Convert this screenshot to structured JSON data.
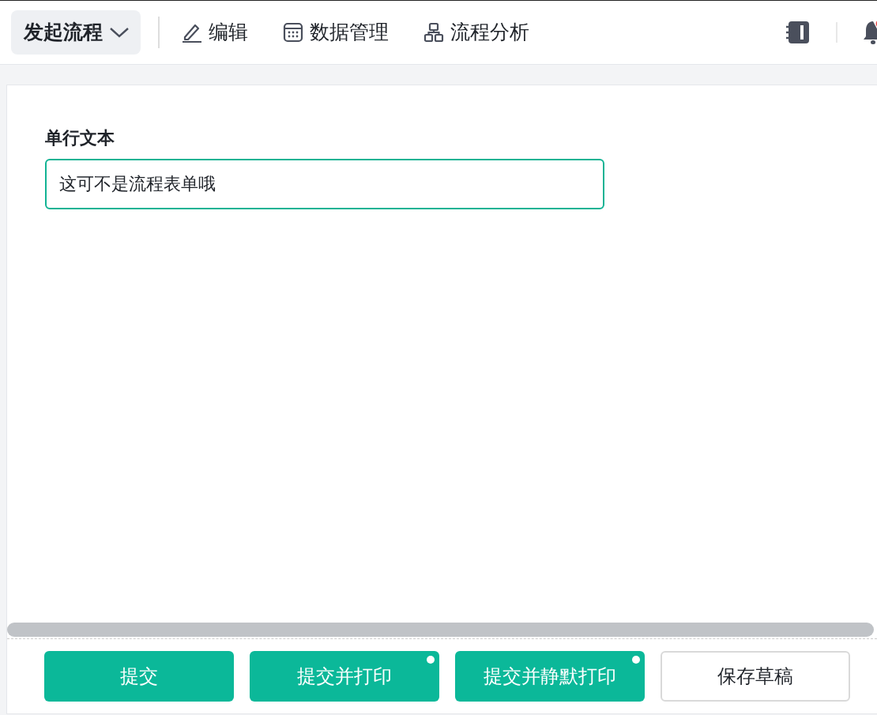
{
  "toolbar": {
    "menu": {
      "label": "发起流程",
      "expanded": false
    },
    "items": [
      {
        "kind": "edit",
        "label": "编辑"
      },
      {
        "kind": "data",
        "label": "数据管理"
      },
      {
        "kind": "analysis",
        "label": "流程分析"
      }
    ],
    "notifications": {
      "unread": true
    }
  },
  "form": {
    "fields": [
      {
        "label": "单行文本",
        "value": "这可不是流程表单哦",
        "focused": true
      }
    ]
  },
  "actions": [
    {
      "label": "提交",
      "kind": "primary",
      "dot": false
    },
    {
      "label": "提交并打印",
      "kind": "primary",
      "dot": true
    },
    {
      "label": "提交并静默打印",
      "kind": "primary",
      "dot": true
    },
    {
      "label": "保存草稿",
      "kind": "default",
      "dot": false
    }
  ]
}
